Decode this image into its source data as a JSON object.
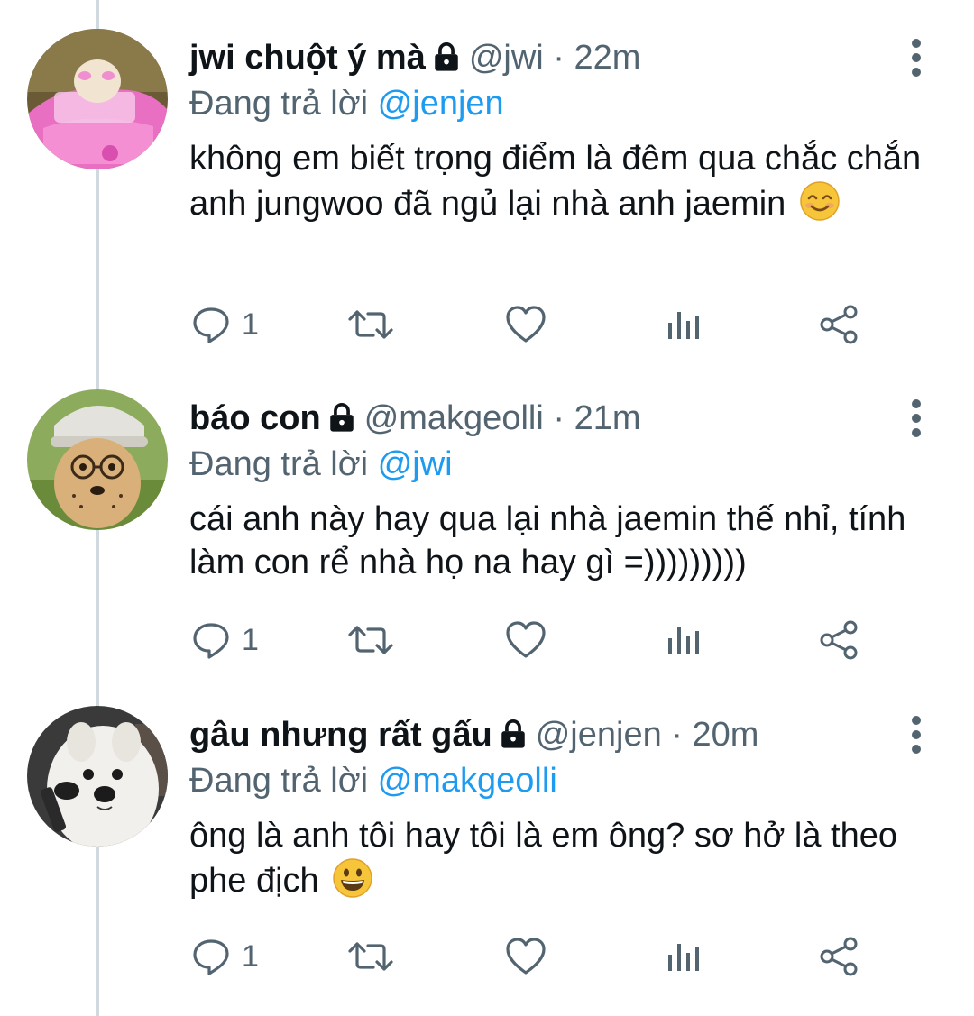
{
  "tweets": [
    {
      "name": "jwi chuột ý mà",
      "handle": "@jwi",
      "separator": "·",
      "time": "22m",
      "reply_prefix": "Đang trả lời",
      "reply_to": "@jenjen",
      "text": "không em biết trọng điểm là đêm qua chắc chắn anh jungwoo đã ngủ lại nhà anh jaemin",
      "emoji": "smiling-face-with-smiling-eyes",
      "reply_count": "1",
      "avatar": "pink-toy-car-hamster"
    },
    {
      "name": "báo con",
      "handle": "@makgeolli",
      "separator": "·",
      "time": "21m",
      "reply_prefix": "Đang trả lời",
      "reply_to": "@jwi",
      "text": "cái anh này hay qua lại nhà jaemin thế nhỉ, tính làm con rể nhà họ na hay gì =)))))))))",
      "emoji": "",
      "reply_count": "1",
      "avatar": "cheetah-cub-with-glasses"
    },
    {
      "name": "gâu nhưng rất gấu",
      "handle": "@jenjen",
      "separator": "·",
      "time": "20m",
      "reply_prefix": "Đang trả lời",
      "reply_to": "@makgeolli",
      "text": "ông là anh tôi hay tôi là em ông? sơ hở là theo phe địch",
      "emoji": "grinning-face",
      "reply_count": "1",
      "avatar": "white-dog-with-microphone"
    }
  ],
  "colors": {
    "text": "#0f1419",
    "secondary": "#536471",
    "link": "#1d9bf0",
    "thread_line": "#cfd9de"
  },
  "icons": [
    "lock-icon",
    "more-vertical-icon",
    "reply-icon",
    "retweet-icon",
    "like-icon",
    "views-icon",
    "share-icon"
  ]
}
